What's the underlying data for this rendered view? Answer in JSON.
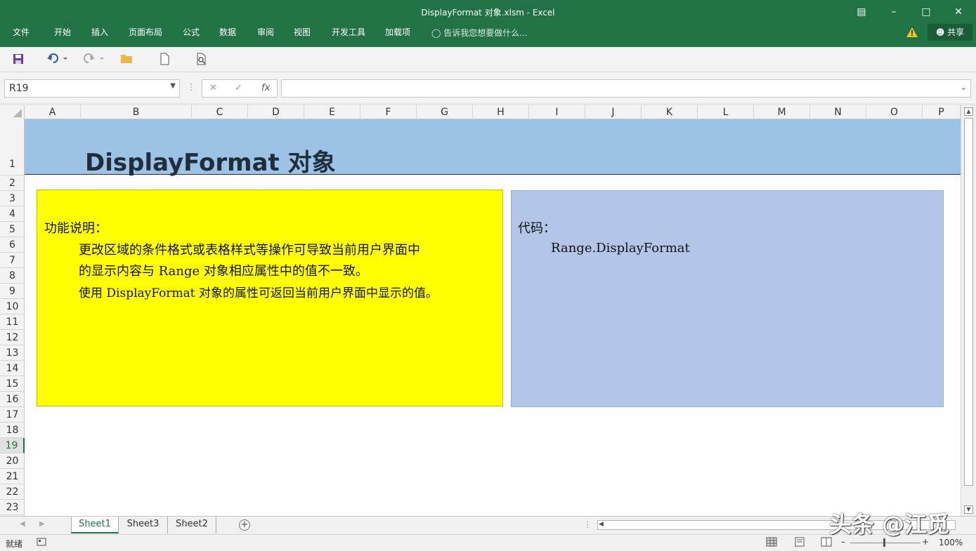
{
  "window": {
    "title": "DisplayFormat 对象.xlsm - Excel"
  },
  "menu": {
    "items": [
      "文件",
      "开始",
      "插入",
      "页面布局",
      "公式",
      "数据",
      "审阅",
      "视图",
      "开发工具",
      "加载项"
    ],
    "tellme": "告诉我您想要做什么...",
    "share": "共享"
  },
  "formula": {
    "namebox": "R19",
    "fx": "fx",
    "value": ""
  },
  "columns": [
    "A",
    "B",
    "C",
    "D",
    "E",
    "F",
    "G",
    "H",
    "I",
    "J",
    "K",
    "L",
    "M",
    "N",
    "O",
    "P"
  ],
  "rows": [
    "1",
    "2",
    "3",
    "4",
    "5",
    "6",
    "7",
    "8",
    "9",
    "10",
    "11",
    "12",
    "13",
    "14",
    "15",
    "16",
    "17",
    "18",
    "19",
    "20",
    "21",
    "22",
    "23"
  ],
  "sheet": {
    "banner_title": "DisplayFormat 对象",
    "yellow": {
      "heading": "功能说明：",
      "line1": "更改区域的条件格式或表格样式等操作可导致当前用户界面中",
      "line2": "的显示内容与 Range 对象相应属性中的值不一致。",
      "line3": "使用 DisplayFormat 对象的属性可返回当前用户界面中显示的值。"
    },
    "blue": {
      "heading": "代码：",
      "code": "Range.DisplayFormat"
    }
  },
  "tabs": {
    "items": [
      "Sheet1",
      "Sheet3",
      "Sheet2"
    ],
    "active": "Sheet1"
  },
  "status": {
    "ready": "就绪",
    "zoom": "100%"
  },
  "watermark": "头条 @江觅",
  "colors": {
    "excel_green": "#217346",
    "banner_blue": "#9cc2e5",
    "yellow": "#ffff00",
    "code_blue": "#b4c6e7"
  }
}
